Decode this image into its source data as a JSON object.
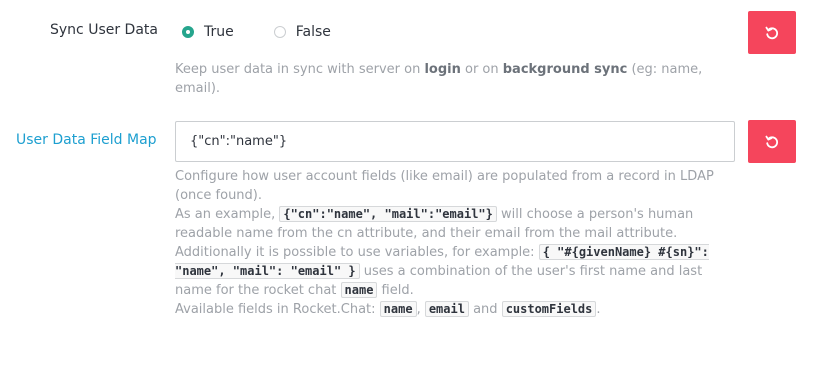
{
  "sync_user_data": {
    "label": "Sync User Data",
    "option_true": "True",
    "option_false": "False",
    "selected": "True",
    "hint_1": "Keep user data in sync with server on ",
    "hint_login": "login",
    "hint_2": " or on ",
    "hint_background_sync": "background sync",
    "hint_3": " (eg: name, email)."
  },
  "user_data_field_map": {
    "label": "User Data Field Map",
    "value": "{\"cn\":\"name\"}",
    "hint_line1": "Configure how user account fields (like email) are populated from a record in LDAP (once found).",
    "hint_example_prefix": "As an example, ",
    "hint_example_code": "{\"cn\":\"name\", \"mail\":\"email\"}",
    "hint_example_suffix": " will choose a person's human readable name from the cn attribute, and their email from the mail attribute. Additionally it is possible to use variables, for example: ",
    "hint_vars_code": "{ \"#{givenName} #{sn}\": \"name\", \"mail\": \"email\" }",
    "hint_vars_suffix": " uses a combination of the user's first name and last name for the rocket chat ",
    "hint_name_code": "name",
    "hint_field_word": " field.",
    "hint_available_prefix": "Available fields in Rocket.Chat: ",
    "hint_available_fields": [
      "name",
      "email",
      "customFields"
    ],
    "hint_sep_comma": ", ",
    "hint_sep_and": " and ",
    "hint_end": "."
  },
  "colors": {
    "accent": "#1d9fd0",
    "reset": "#f5455c",
    "radio_checked": "#26a58d"
  },
  "icons": {
    "reset": "reset-icon"
  }
}
